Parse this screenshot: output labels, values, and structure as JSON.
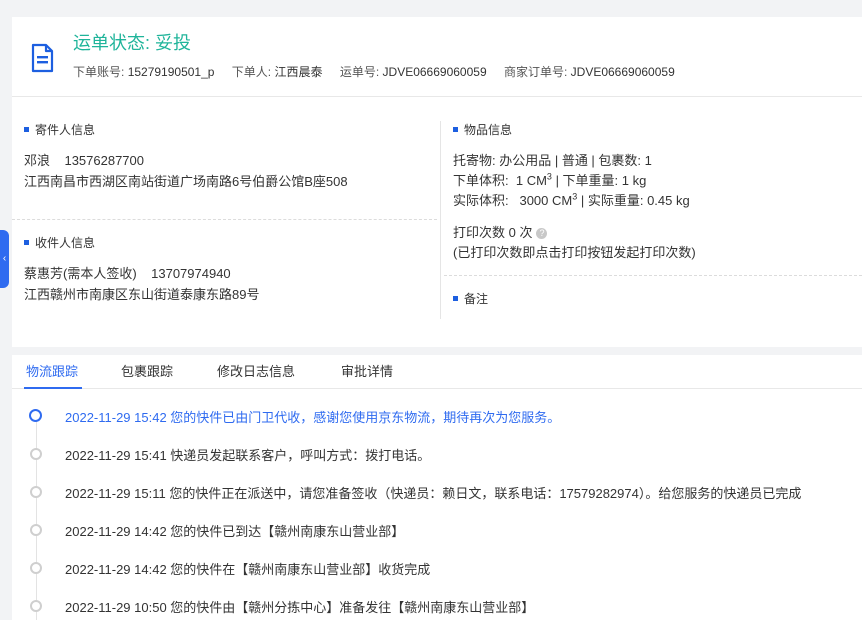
{
  "header": {
    "status_label": "运单状态:",
    "status_value": "妥投",
    "account_label": "下单账号:",
    "account_value": "15279190501_p",
    "orderer_label": "下单人:",
    "orderer_value": "江西晨泰",
    "waybill_label": "运单号:",
    "waybill_value": "JDVE06669060059",
    "merchant_order_label": "商家订单号:",
    "merchant_order_value": "JDVE06669060059"
  },
  "sender": {
    "title": "寄件人信息",
    "name": "邓浪",
    "phone": "13576287700",
    "address": "江西南昌市西湖区南站街道广场南路6号伯爵公馆B座508"
  },
  "receiver": {
    "title": "收件人信息",
    "name": "蔡惠芳(需本人签收)",
    "phone": "13707974940",
    "address": "江西赣州市南康区东山街道泰康东路89号"
  },
  "goods": {
    "title": "物品信息",
    "line1": "托寄物:  办公用品 | 普通 | 包裹数:  1",
    "order_volume_label": "下单体积:",
    "order_volume_value": "1 CM",
    "order_weight": "| 下单重量:  1 kg",
    "actual_volume_label": "实际体积:",
    "actual_volume_value": "3000 CM",
    "actual_weight": "| 实际重量:  0.45 kg",
    "unit_sup": "3",
    "print_count": "打印次数   0 次",
    "print_note": "(已打印次数即点击打印按钮发起打印次数)"
  },
  "remark": {
    "title": "备注"
  },
  "tabs": [
    {
      "label": "物流跟踪"
    },
    {
      "label": "包裹跟踪"
    },
    {
      "label": "修改日志信息"
    },
    {
      "label": "审批详情"
    }
  ],
  "timeline": [
    {
      "text": "2022-11-29 15:42  您的快件已由门卫代收，感谢您使用京东物流，期待再次为您服务。"
    },
    {
      "text": "2022-11-29 15:41  快递员发起联系客户，呼叫方式：拨打电话。"
    },
    {
      "text": "2022-11-29 15:11  您的快件正在派送中，请您准备签收（快递员：赖日文，联系电话：17579282974）。给您服务的快递员已完成"
    },
    {
      "text": "2022-11-29 14:42  您的快件已到达【赣州南康东山营业部】"
    },
    {
      "text": "2022-11-29 14:42  您的快件在【赣州南康东山营业部】收货完成"
    },
    {
      "text": "2022-11-29 10:50  您的快件由【赣州分拣中心】准备发往【赣州南康东山营业部】"
    }
  ],
  "colors": {
    "status": "#1fb49a",
    "accent": "#2f6bf0"
  },
  "icons": {
    "header": "document-icon",
    "side_tab": "chevron-left-icon",
    "help": "question-icon"
  }
}
